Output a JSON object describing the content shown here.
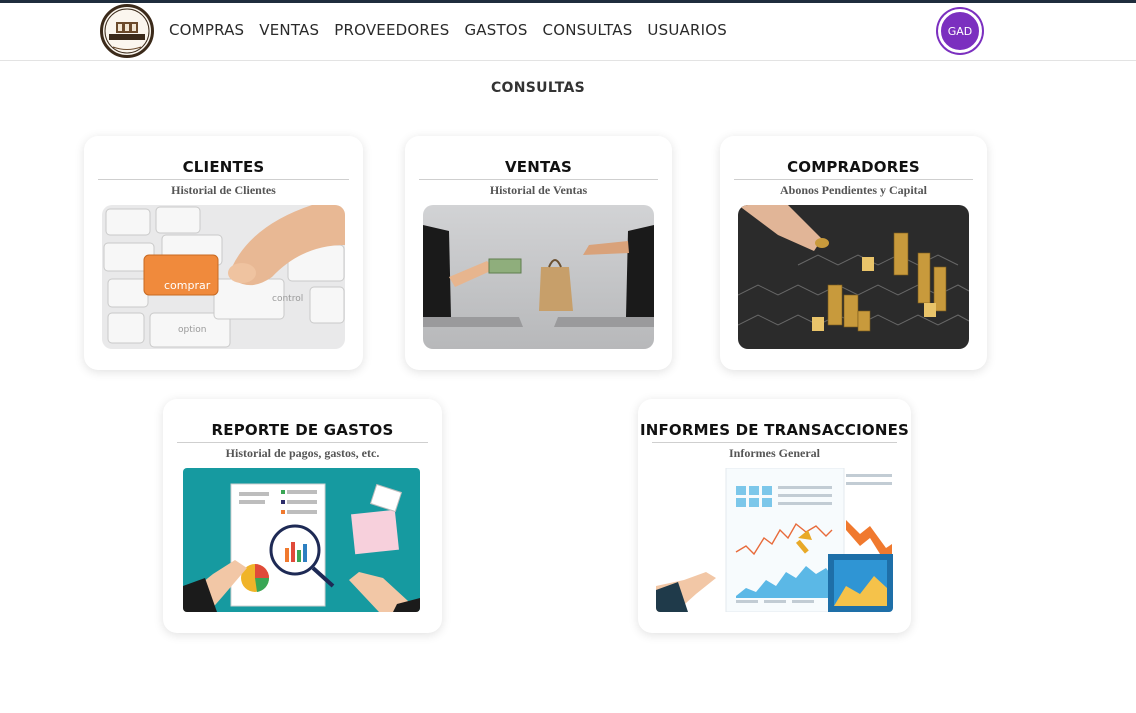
{
  "header": {
    "logo_top_text": "COMPRAS Y VENTA",
    "logo_main_text": "BODEGA - GAD",
    "logo_bottom_text": "DE CAFE",
    "nav": [
      "COMPRAS",
      "VENTAS",
      "PROVEEDORES",
      "GASTOS",
      "CONSULTAS",
      "USUARIOS"
    ],
    "avatar_text": "GAD"
  },
  "page": {
    "title": "CONSULTAS"
  },
  "cards": [
    {
      "title": "CLIENTES",
      "subtitle": "Historial de Clientes",
      "image_key_text": "comprar",
      "image_key_text_2": "option",
      "image_key_text_3": "control",
      "image": "keyboard-buy-image"
    },
    {
      "title": "VENTAS",
      "subtitle": "Historial de Ventas",
      "image": "laptop-exchange-image"
    },
    {
      "title": "COMPRADORES",
      "subtitle": "Abonos Pendientes y Capital",
      "image": "coin-stacks-image"
    },
    {
      "title": "REPORTE DE GASTOS",
      "subtitle": "Historial de pagos, gastos, etc.",
      "image": "expense-report-image"
    },
    {
      "title": "INFORMES DE TRANSACCIONES",
      "subtitle": "Informes General",
      "image": "transaction-charts-image"
    }
  ],
  "colors": {
    "avatar": "#7b2fbf",
    "topbar": "#1f2d3d",
    "report_bg": "#169aa0",
    "key_orange": "#f08a3c"
  }
}
